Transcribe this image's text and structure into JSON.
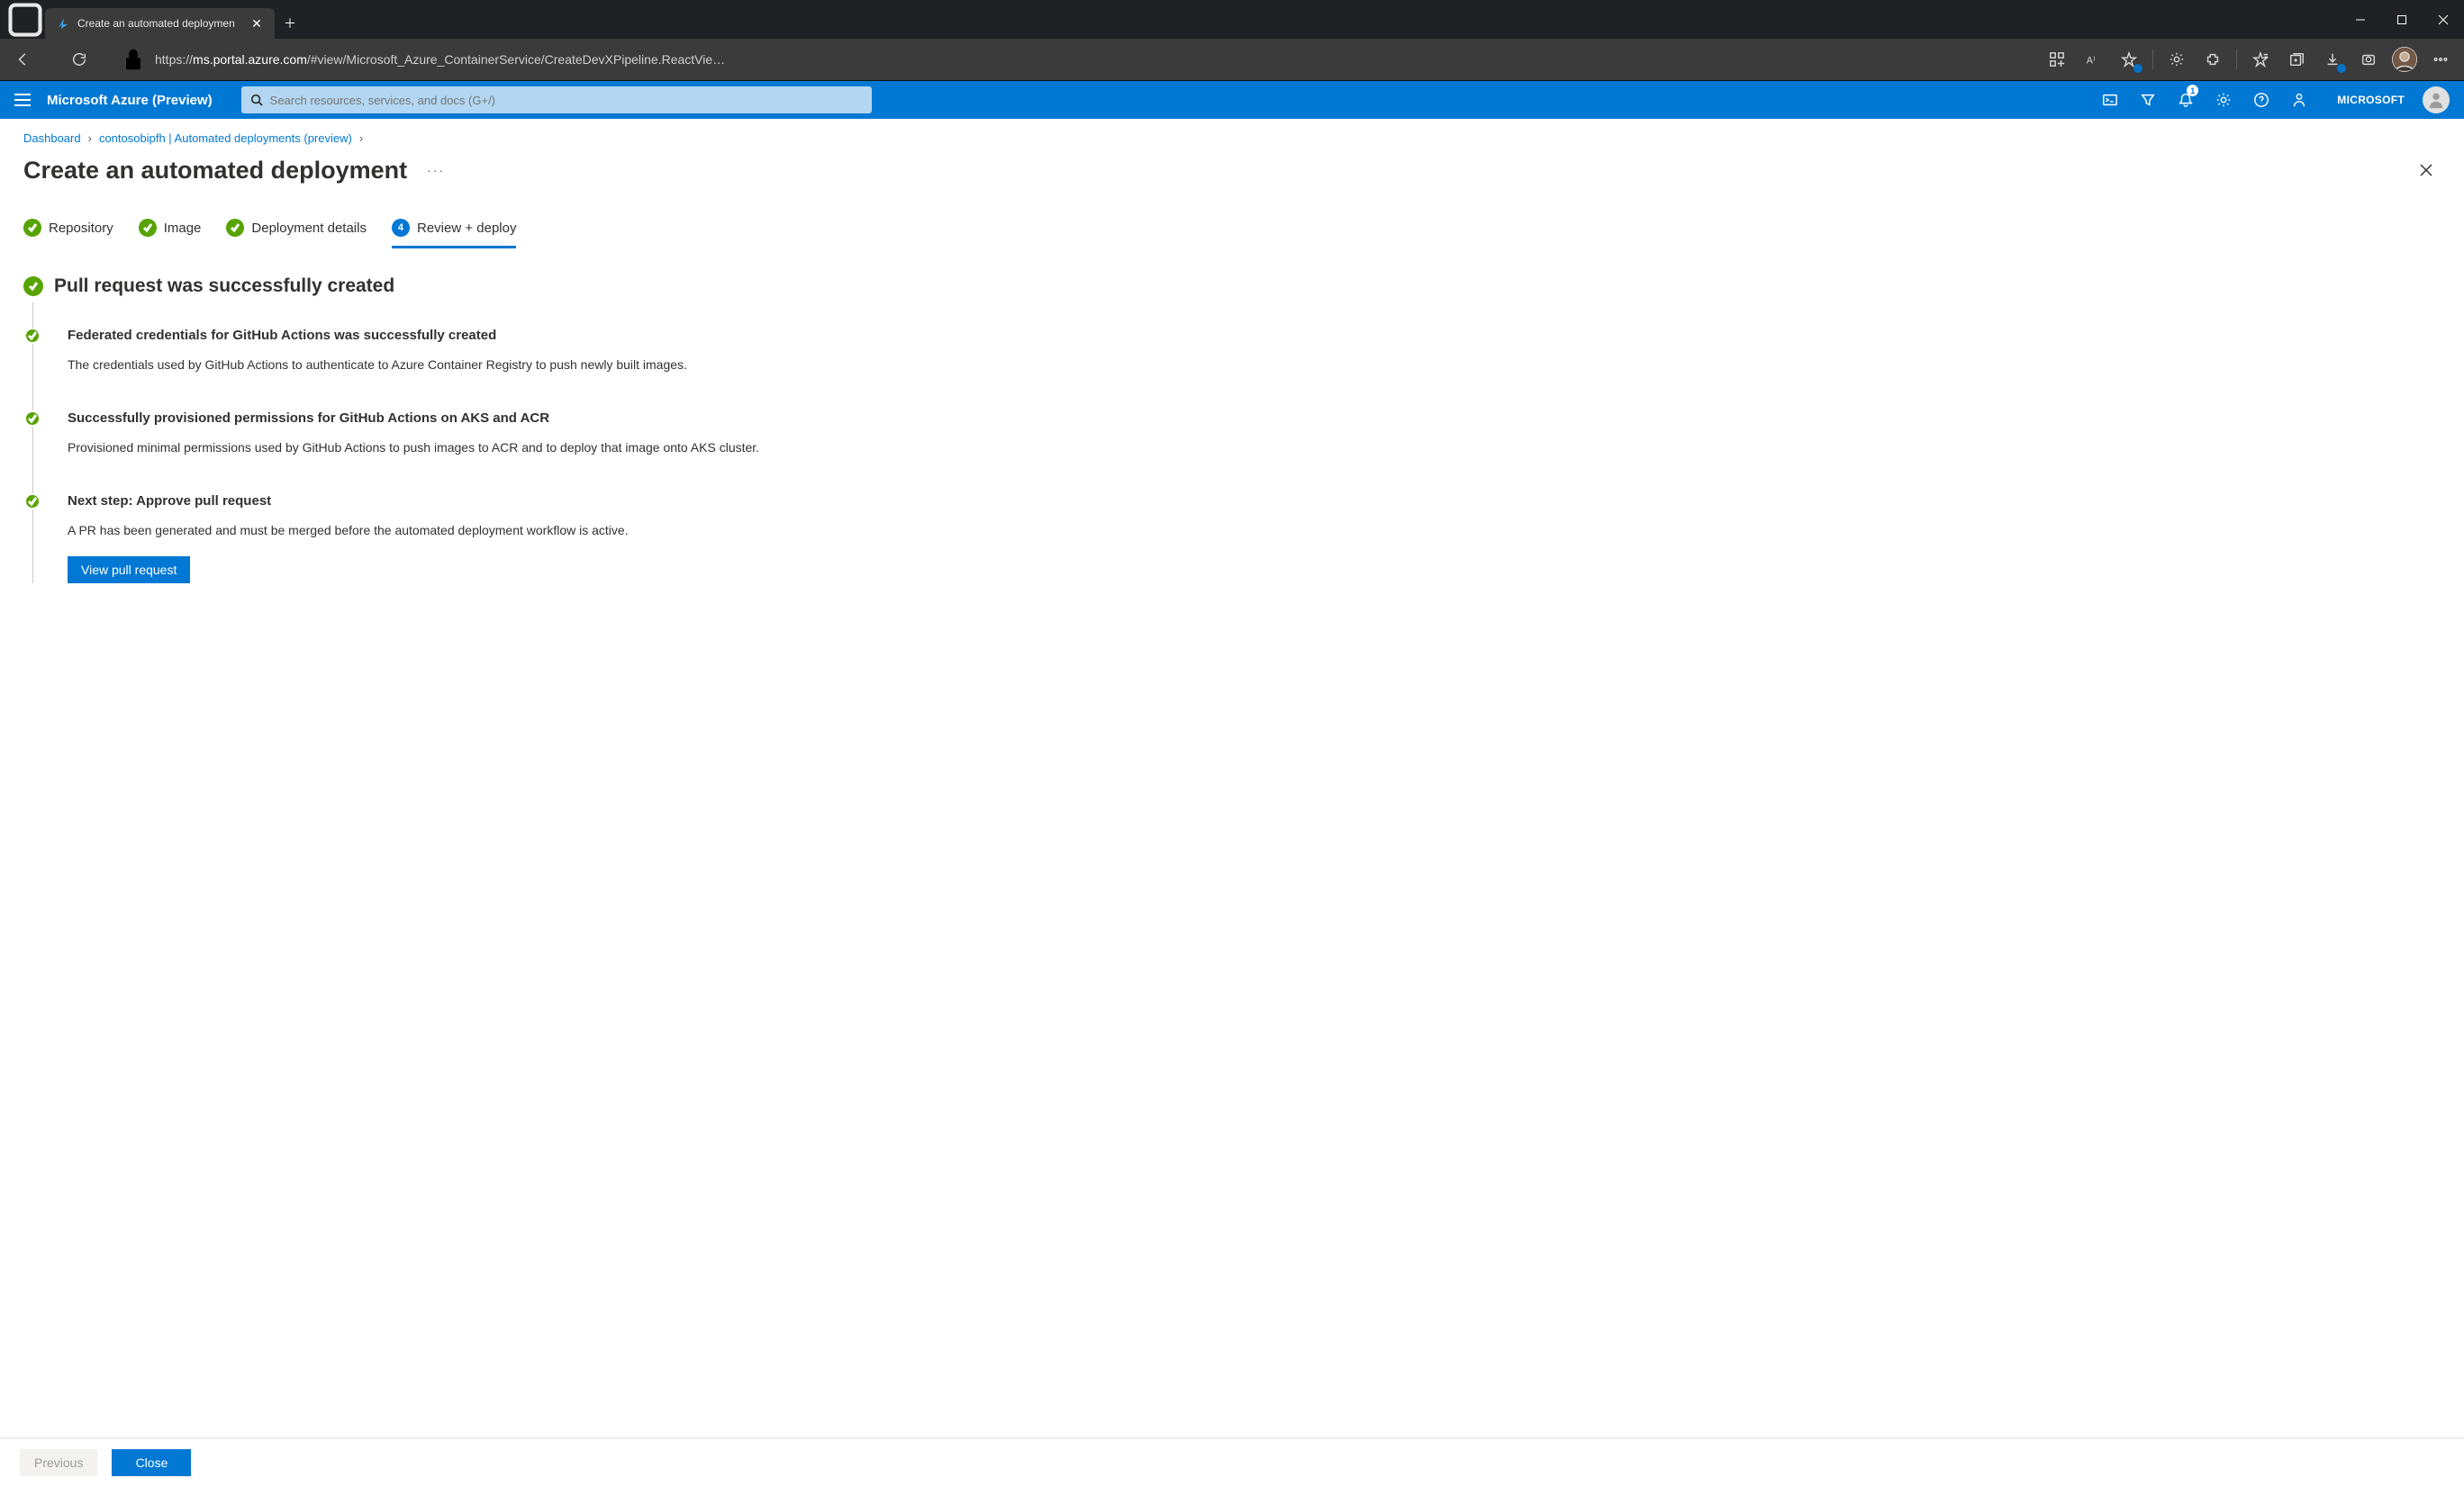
{
  "browser": {
    "tab_title": "Create an automated deploymen",
    "url_display_prefix": "https://",
    "url_display_host": "ms.portal.azure.com",
    "url_display_path": "/#view/Microsoft_Azure_ContainerService/CreateDevXPipeline.ReactVie…"
  },
  "azure": {
    "brand": "Microsoft Azure (Preview)",
    "search_placeholder": "Search resources, services, and docs (G+/)",
    "tenant": "MICROSOFT",
    "notification_count": "1"
  },
  "breadcrumbs": {
    "items": [
      "Dashboard",
      "contosobipfh | Automated deployments (preview)"
    ]
  },
  "page": {
    "title": "Create an automated deployment",
    "more": "···"
  },
  "wizard": {
    "steps": [
      {
        "label": "Repository"
      },
      {
        "label": "Image"
      },
      {
        "label": "Deployment details"
      },
      {
        "label": "Review + deploy",
        "number": "4"
      }
    ]
  },
  "status": {
    "headline": "Pull request was successfully created",
    "items": [
      {
        "title": "Federated credentials for GitHub Actions was successfully created",
        "desc": "The credentials used by GitHub Actions to authenticate to Azure Container Registry to push newly built images."
      },
      {
        "title": "Successfully provisioned permissions for GitHub Actions on AKS and ACR",
        "desc": "Provisioned minimal permissions used by GitHub Actions to push images to ACR and to deploy that image onto AKS cluster."
      },
      {
        "title": "Next step: Approve pull request",
        "desc": "A PR has been generated and must be merged before the automated deployment workflow is active.",
        "action": "View pull request"
      }
    ]
  },
  "footer": {
    "previous": "Previous",
    "close": "Close"
  }
}
